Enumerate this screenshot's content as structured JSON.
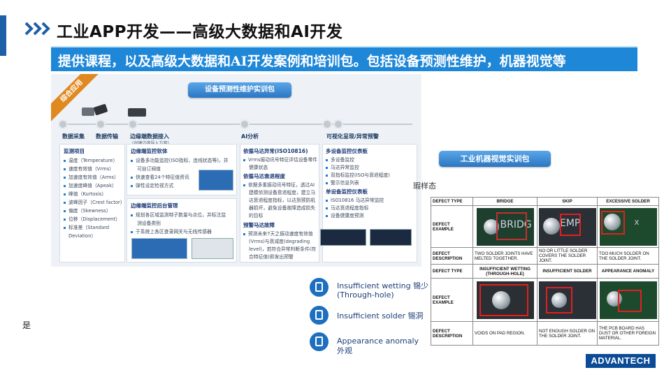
{
  "title": "工业APP开发——高级大数据和AI开发",
  "banner": "提供课程，以及高级大数据和AI开发案例和培训包。包括设备预测性维护，机器视觉等",
  "diagram": {
    "ribbon": "综合应用",
    "pill": "设备预测性维护实训包",
    "stages": [
      {
        "label": "数据采集"
      },
      {
        "label": "数据传输"
      },
      {
        "label": "边缘端数据接入",
        "sub": "(创建边缘导入方案)"
      },
      {
        "label": "AI分析"
      },
      {
        "label": "可视化呈现/异常预警"
      }
    ],
    "col1": {
      "title": "监测项目",
      "items": [
        "温度（Temperature）",
        "速度有效值（Vrms）",
        "加速度有效值（Arms）",
        "加速度峰值（Apeak）",
        "峰值（Kurtosis）",
        "波峰因子（Crest factor）",
        "偏度（Skewness）",
        "位移（Displacement）",
        "标准差（Standard",
        "Deviation）"
      ]
    },
    "col2a": {
      "title": "边缘端监控软体",
      "items": [
        "设备多功能监控(ISO指标、连线状态等)，并",
        "可自订阀值",
        "快速查看24个特征值资讯",
        "弹性设定检视方式"
      ]
    },
    "col2b": {
      "title": "边缘端监控后台管理",
      "items": [
        "规划各区域监测特子数量与点位，并标注监",
        "测设备类别",
        "于系统上各区查录网关与无线传感器"
      ]
    },
    "col3": {
      "t1": "依循马达异常(ISO10816)",
      "i1": [
        "Vrms振动讯号特征评估设备零件",
        "健康状态"
      ],
      "t2": "依循马达衰退程度",
      "i2": [
        "依据多重振动讯号特征，透过AI",
        "建模侦测设备衰退程度，建立马",
        "达衰退程度指标，以达到预防机",
        "器损坏，避免设备故障造成损失",
        "的目标"
      ],
      "t3": "预警马达故障",
      "i3": [
        "预测未来7天之振动速度有效值",
        "(Vrms)与衰减度(degrading",
        "level)，若符合异常判断条件(符",
        "合特征值)即发出预警"
      ]
    },
    "col4": {
      "t1": "多设备监控仪表板",
      "i1": [
        "多设备监控",
        "马达异常监控",
        "双指标监控(ISO与衰退程度)",
        "警示信息列表"
      ],
      "t2": "单设备监控仪表板",
      "i2": [
        "ISO10816 马达异常监控",
        "马达衰退程度指标",
        "设备健康度预测"
      ]
    }
  },
  "vision_pill": "工业机器视觉实训包",
  "sample_text": "瑕样态",
  "defects": [
    {
      "en": "Insufficient wetting",
      "cn": "锡少",
      "en2": "(Through-hole)"
    },
    {
      "en": "Insufficient solder",
      "cn": "锡洞"
    },
    {
      "en": "Appearance anomaly",
      "cn": "外观"
    }
  ],
  "table": {
    "row1": {
      "h0": "Defect Type",
      "h1": "Bridge",
      "h2": "Skip",
      "h3": "Excessive solder"
    },
    "row2": {
      "label": "Defect Example"
    },
    "row3": {
      "label": "Defect Description",
      "d1": "Two solder joints have melted together.",
      "d2": "No or little solder covers the solder joint.",
      "d3": "Too much solder on the solder joint."
    },
    "row4": {
      "h0": "Defect Type",
      "h1": "Insufficient wetting (Through-hole)",
      "h2": "Insufficient solder",
      "h3": "Appearance Anomaly"
    },
    "row5": {
      "label": "Defect Example"
    },
    "row6": {
      "label": "Defect Description",
      "d1": "Voids on pad region.",
      "d2": "Not enough solder on the solder joint.",
      "d3": "The PCB board has dust or other foreign material."
    },
    "pcb_text": [
      "bridg",
      "emp",
      "x"
    ]
  },
  "logo": "ADVANTECH",
  "stray_text": "是"
}
